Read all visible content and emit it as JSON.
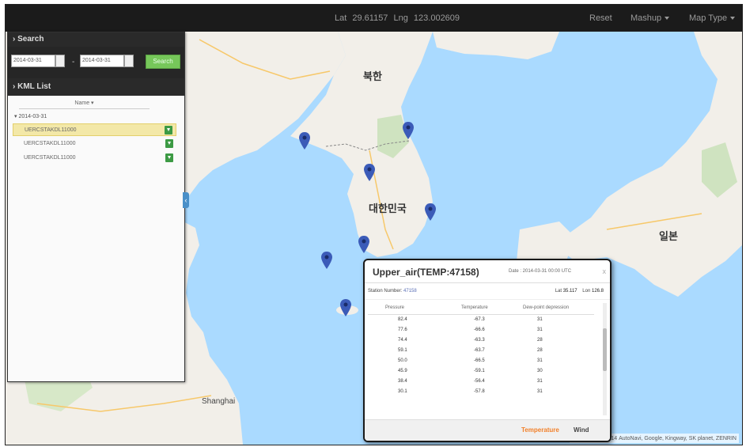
{
  "navbar": {
    "lat_label": "Lat",
    "lat_value": "29.61157",
    "lng_label": "Lng",
    "lng_value": "123.002609",
    "reset_label": "Reset",
    "mashup_label": "Mashup",
    "maptype_label": "Map Type"
  },
  "panel": {
    "search_title": "› Search",
    "start_date": "2014-03-31",
    "end_date": "2014-03-31",
    "search_button": "Search",
    "kml_title": "› KML List",
    "tree_header": "Name",
    "folder": "2014-03-31",
    "items": [
      {
        "label": "UERCSTAKDL11000"
      },
      {
        "label": "UERCSTAKDL11000"
      },
      {
        "label": "UERCSTAKDL11000"
      }
    ]
  },
  "map_labels": {
    "north_korea": "북한",
    "south_korea": "대한민국",
    "japan": "일본",
    "shanghai": "Shanghai"
  },
  "popup": {
    "title": "Upper_air(TEMP:47158)",
    "date": "Date : 2014-03-31 00:00 UTC",
    "close": "x",
    "station_label": "Station Number:",
    "station_value": "47158",
    "lat_label": "Lat",
    "lat_value": "35.117",
    "lon_label": "Lon",
    "lon_value": "126.8",
    "columns": [
      "Pressure",
      "Temperature",
      "Dew-point depression"
    ],
    "rows": [
      [
        "82.4",
        "-67.3",
        "31"
      ],
      [
        "77.6",
        "-66.6",
        "31"
      ],
      [
        "74.4",
        "-63.3",
        "28"
      ],
      [
        "59.1",
        "-63.7",
        "28"
      ],
      [
        "50.0",
        "-66.5",
        "31"
      ],
      [
        "45.9",
        "-59.1",
        "30"
      ],
      [
        "38.4",
        "-56.4",
        "31"
      ],
      [
        "30.1",
        "-57.8",
        "31"
      ]
    ],
    "tab_temperature": "Temperature",
    "tab_wind": "Wind"
  },
  "attribution": "지도 데이터 ©2014 AutoNavi, Google, Kingway, SK planet, ZENRIN",
  "colors": {
    "navbar": "#1b1b1b",
    "water": "#aadaff",
    "land": "#f2efe9",
    "accent_orange": "#f2802a",
    "pin": "#3b5bb8"
  }
}
